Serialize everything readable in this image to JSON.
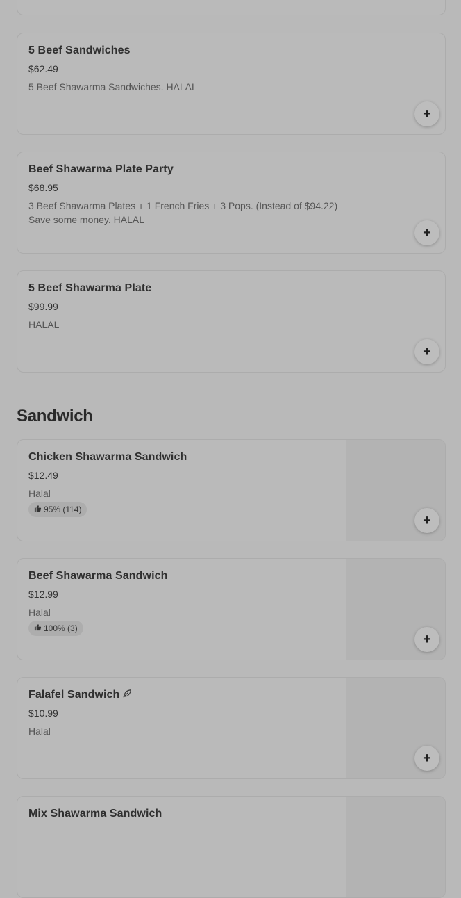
{
  "combo_items": [
    {
      "title": "5 Beef Sandwiches",
      "price": "$62.49",
      "description": "5 Beef Shawarma Sandwiches. HALAL"
    },
    {
      "title": "Beef Shawarma Plate Party",
      "price": "$68.95",
      "description": "3 Beef Shawarma Plates + 1 French Fries + 3 Pops. (Instead of $94.22) Save some money. HALAL"
    },
    {
      "title": "5 Beef Shawarma Plate",
      "price": "$99.99",
      "description": "HALAL"
    }
  ],
  "sandwich_section": {
    "title": "Sandwich",
    "items": [
      {
        "title": "Chicken Shawarma Sandwich",
        "price": "$12.49",
        "description": "Halal",
        "rating": "95% (114)"
      },
      {
        "title": "Beef Shawarma Sandwich",
        "price": "$12.99",
        "description": "Halal",
        "rating": "100% (3)"
      },
      {
        "title": "Falafel Sandwich",
        "price": "$10.99",
        "description": "Halal",
        "badge_icon": "leaf-icon"
      },
      {
        "title": "Mix Shawarma Sandwich"
      }
    ]
  },
  "add_button_label": "+",
  "icons": {
    "rating": "thumbs-up-icon",
    "vegetarian": "leaf-icon",
    "add": "plus-icon"
  }
}
